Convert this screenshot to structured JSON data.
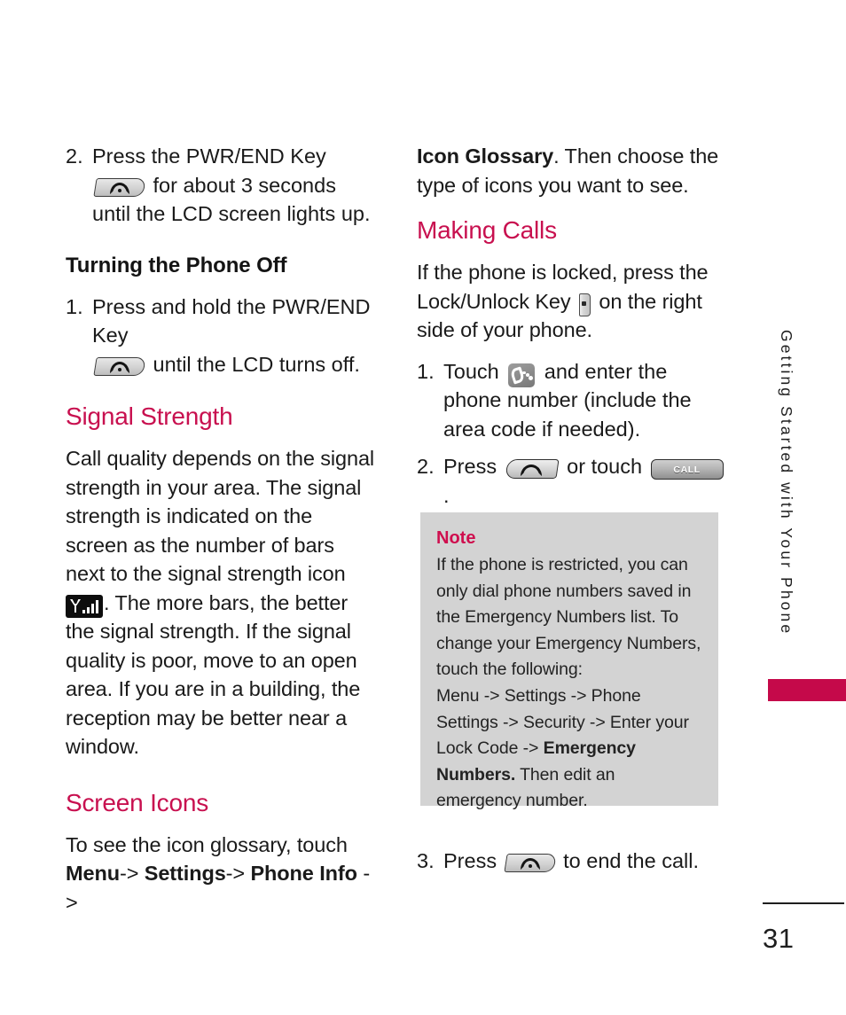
{
  "page": {
    "number": "31",
    "side_title": "Getting Started with Your Phone"
  },
  "left_column": {
    "step_power_on": {
      "num": "2.",
      "text_before": "Press the PWR/END Key",
      "text_after": "for about 3 seconds until the LCD screen lights up.",
      "icon": "pwr-end-key-icon"
    },
    "heading_turning_off": "Turning the Phone Off",
    "step_power_off": {
      "num": "1.",
      "text_before": "Press and hold the PWR/END Key",
      "text_after": "until the LCD turns off.",
      "icon": "pwr-end-key-icon"
    },
    "heading_signal_strength": "Signal Strength",
    "signal_paragraph_1": "Call quality depends on the signal strength in your area. The signal strength is indicated on the screen as the number of bars next to the signal strength icon",
    "signal_paragraph_2": ". The more bars, the better the signal strength. If the signal quality is poor, move to an open area. If you are in a building, the reception may be better near a window.",
    "signal_icon": "signal-strength-icon",
    "heading_screen_icons": "Screen Icons",
    "screen_icons_intro": "To see the icon glossary, touch",
    "menu_path": [
      {
        "label": "Menu",
        "bold": true
      },
      {
        "label": "-> ",
        "bold": false
      },
      {
        "label": "Settings",
        "bold": true
      },
      {
        "label": "-> ",
        "bold": false
      },
      {
        "label": "Phone Info",
        "bold": true
      },
      {
        "label": " ->",
        "bold": false
      }
    ],
    "menu_path_menu": "Menu",
    "menu_path_arrow1": "->",
    "menu_path_settings": "Settings",
    "menu_path_arrow2": "->",
    "menu_path_phone_info": "Phone Info",
    "menu_path_arrow3": "->"
  },
  "right_column": {
    "icon_glossary_bold": "Icon Glossary",
    "icon_glossary_rest": ". Then choose the type of icons you want to see.",
    "heading_making_calls": "Making Calls",
    "locked_text_before": "If the phone is locked, press the Lock/Unlock Key",
    "locked_text_after": "on the right side of your phone.",
    "lock_key_icon": "lock-unlock-key-icon",
    "step_touch": {
      "num": "1.",
      "text_before": "Touch",
      "text_after": "and enter the phone number (include the area code if needed).",
      "icon": "dial-app-icon"
    },
    "step_press": {
      "num": "2.",
      "text_before": "Press",
      "text_middle": "or touch",
      "text_after": ".",
      "send_key_icon": "send-key-icon",
      "call_button_label": "CALL"
    },
    "step_end": {
      "num": "3.",
      "text_before": "Press",
      "text_after": "to end the call.",
      "icon": "pwr-end-key-icon"
    }
  },
  "note": {
    "title": "Note",
    "line_1": "If the phone is restricted, you can only dial phone numbers saved in the Emergency Numbers list. To change your Emergency Numbers, touch the following:",
    "line_2": "Menu -> Settings -> Phone Settings -> Security -> Enter your Lock Code ->",
    "line_3_bold": "Emergency Numbers.",
    "line_3_rest": " Then edit an emergency number."
  },
  "colors": {
    "accent_red": "#c8104f",
    "tab_red": "#c5094a",
    "note_bg": "#d3d3d3",
    "text": "#1a1a1a"
  }
}
